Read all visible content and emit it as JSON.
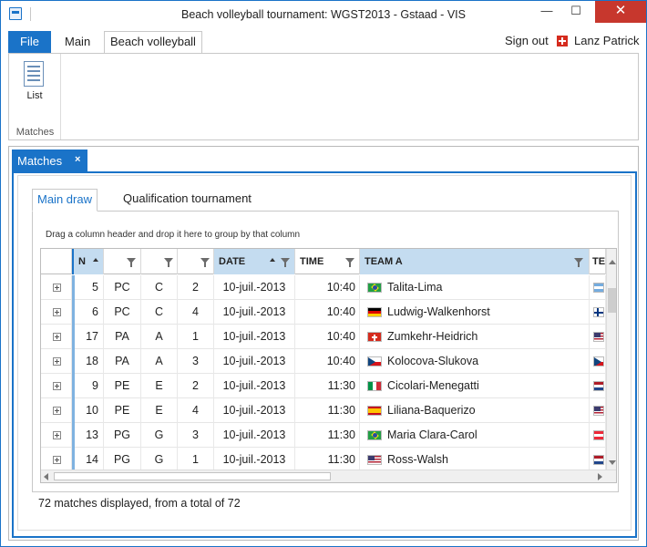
{
  "window": {
    "title": "Beach volleyball tournament: WGST2013 - Gstaad - VIS",
    "minimize_glyph": "—",
    "maximize_glyph": "☐",
    "close_glyph": "✕"
  },
  "ribbon": {
    "tabs": [
      "File",
      "Main",
      "Beach volleyball"
    ],
    "active_tab": "Beach volleyball",
    "sign_out": "Sign out",
    "user": "Lanz Patrick",
    "group_label": "Matches",
    "list_button": "List"
  },
  "document": {
    "tab_label": "Matches",
    "tab_close": "×",
    "inner_tabs": [
      "Main draw",
      "Qualification tournament"
    ],
    "active_inner_tab": "Main draw",
    "group_hint": "Drag a column header and drop it here to group by that column",
    "status": "72 matches displayed, from a total of 72"
  },
  "grid": {
    "columns": [
      "N",
      "",
      "",
      "",
      "DATE",
      "TIME",
      "TEAM A",
      "TEA"
    ],
    "sorted_column": "DATE",
    "rows": [
      {
        "no": "5",
        "cat": "PC",
        "pool": "C",
        "rnd": "2",
        "date": "10-juil.-2013",
        "time": "10:40",
        "team_a": "Talita-Lima",
        "flag_a": "BRA",
        "flag_b": "ARG"
      },
      {
        "no": "6",
        "cat": "PC",
        "pool": "C",
        "rnd": "4",
        "date": "10-juil.-2013",
        "time": "10:40",
        "team_a": "Ludwig-Walkenhorst",
        "flag_a": "GER",
        "flag_b": "FIN"
      },
      {
        "no": "17",
        "cat": "PA",
        "pool": "A",
        "rnd": "1",
        "date": "10-juil.-2013",
        "time": "10:40",
        "team_a": "Zumkehr-Heidrich",
        "flag_a": "SUI",
        "flag_b": "USA"
      },
      {
        "no": "18",
        "cat": "PA",
        "pool": "A",
        "rnd": "3",
        "date": "10-juil.-2013",
        "time": "10:40",
        "team_a": "Kolocova-Slukova",
        "flag_a": "CZE",
        "flag_b": "CZE"
      },
      {
        "no": "9",
        "cat": "PE",
        "pool": "E",
        "rnd": "2",
        "date": "10-juil.-2013",
        "time": "11:30",
        "team_a": "Cicolari-Menegatti",
        "flag_a": "ITA",
        "flag_b": "NED"
      },
      {
        "no": "10",
        "cat": "PE",
        "pool": "E",
        "rnd": "4",
        "date": "10-juil.-2013",
        "time": "11:30",
        "team_a": "Liliana-Baquerizo",
        "flag_a": "ESP",
        "flag_b": "USA"
      },
      {
        "no": "13",
        "cat": "PG",
        "pool": "G",
        "rnd": "3",
        "date": "10-juil.-2013",
        "time": "11:30",
        "team_a": "Maria Clara-Carol",
        "flag_a": "BRA",
        "flag_b": "AUT"
      },
      {
        "no": "14",
        "cat": "PG",
        "pool": "G",
        "rnd": "1",
        "date": "10-juil.-2013",
        "time": "11:30",
        "team_a": "Ross-Walsh",
        "flag_a": "USA",
        "flag_b": "NED"
      }
    ]
  },
  "colors": {
    "accent": "#1a73c8",
    "sorted_header": "#c4dcf0",
    "close_button": "#c7372d"
  }
}
